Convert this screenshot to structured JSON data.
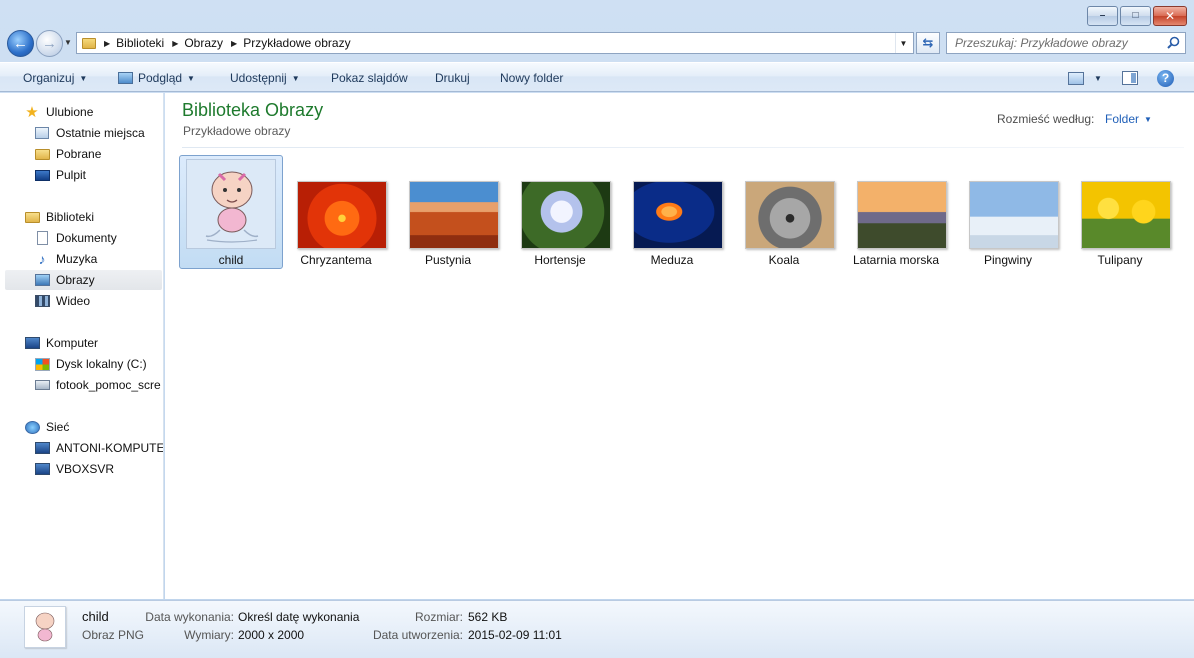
{
  "window": {
    "minimize": "–",
    "maximize": "□",
    "close": "✕"
  },
  "nav": {
    "breadcrumbs": [
      "Biblioteki",
      "Obrazy",
      "Przykładowe obrazy"
    ],
    "search_placeholder": "Przeszukaj: Przykładowe obrazy"
  },
  "toolbar": {
    "organize": "Organizuj",
    "preview": "Podgląd",
    "share": "Udostępnij",
    "slideshow": "Pokaz slajdów",
    "print": "Drukuj",
    "new_folder": "Nowy folder",
    "help": "?"
  },
  "sidebar": {
    "favorites": "Ulubione",
    "recent": "Ostatnie miejsca",
    "downloads": "Pobrane",
    "desktop": "Pulpit",
    "libraries": "Biblioteki",
    "documents": "Dokumenty",
    "music": "Muzyka",
    "pictures": "Obrazy",
    "videos": "Wideo",
    "computer": "Komputer",
    "local_disk": "Dysk lokalny (C:)",
    "network_drive": "fotook_pomoc_scre",
    "network": "Sieć",
    "pc1": "ANTONI-KOMPUTE",
    "pc2": "VBOXSVR"
  },
  "library": {
    "title": "Biblioteka Obrazy",
    "subtitle": "Przykładowe obrazy",
    "arrange_label": "Rozmieść według:",
    "arrange_value": "Folder"
  },
  "files": [
    "child",
    "Chryzantema",
    "Pustynia",
    "Hortensje",
    "Meduza",
    "Koala",
    "Latarnia morska",
    "Pingwiny",
    "Tulipany"
  ],
  "details": {
    "name": "child",
    "type": "Obraz PNG",
    "date_taken_label": "Data wykonania:",
    "date_taken_value": "Określ datę wykonania",
    "dimensions_label": "Wymiary:",
    "dimensions_value": "2000 x 2000",
    "size_label": "Rozmiar:",
    "size_value": "562 KB",
    "created_label": "Data utworzenia:",
    "created_value": "2015-02-09 11:01"
  }
}
